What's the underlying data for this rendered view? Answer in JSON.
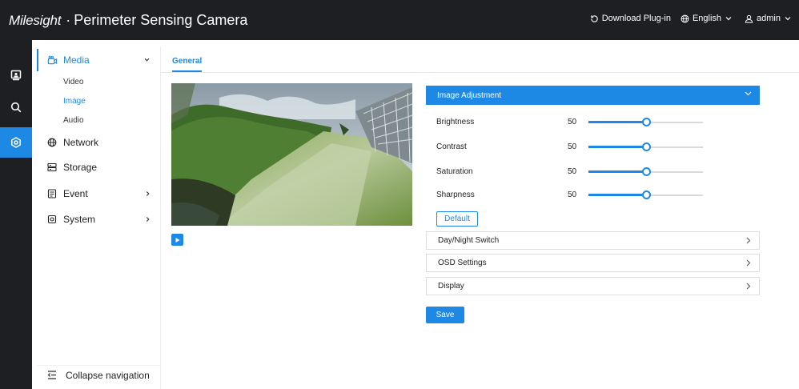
{
  "header": {
    "logo_text": "Milesight",
    "separator": "·",
    "app_title": "Perimeter Sensing Camera",
    "download_plugin": "Download Plug-in",
    "language": "English",
    "user": "admin"
  },
  "rail": {
    "items": [
      {
        "icon": "live-view-icon",
        "active": false
      },
      {
        "icon": "search-icon",
        "active": false
      },
      {
        "icon": "settings-icon",
        "active": true
      }
    ]
  },
  "sidenav": {
    "groups": [
      {
        "label": "Media",
        "icon": "media-icon",
        "expanded": true,
        "active": true
      },
      {
        "label": "Network",
        "icon": "globe-icon",
        "active": false
      },
      {
        "label": "Storage",
        "icon": "storage-icon",
        "active": false
      },
      {
        "label": "Event",
        "icon": "event-icon",
        "active": false
      },
      {
        "label": "System",
        "icon": "system-icon",
        "active": false
      }
    ],
    "media_sub": [
      {
        "label": "Video",
        "active": false
      },
      {
        "label": "Image",
        "active": true
      },
      {
        "label": "Audio",
        "active": false
      }
    ],
    "collapse_label": "Collapse navigation"
  },
  "main": {
    "tab": "General",
    "image_adjustment": {
      "title": "Image Adjustment",
      "sliders": [
        {
          "label": "Brightness",
          "value": "50",
          "fraction": 0.5
        },
        {
          "label": "Contrast",
          "value": "50",
          "fraction": 0.5
        },
        {
          "label": "Saturation",
          "value": "50",
          "fraction": 0.5
        },
        {
          "label": "Sharpness",
          "value": "50",
          "fraction": 0.5
        }
      ],
      "default_button": "Default"
    },
    "sections": [
      {
        "label": "Day/Night Switch"
      },
      {
        "label": "OSD Settings"
      },
      {
        "label": "Display"
      }
    ],
    "save_button": "Save"
  },
  "colors": {
    "accent": "#1e88e5",
    "topbar": "#1e1f23"
  }
}
